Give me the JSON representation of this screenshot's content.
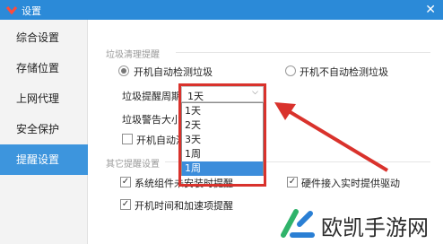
{
  "window": {
    "title": "设置"
  },
  "sidebar": {
    "items": [
      {
        "label": "综合设置"
      },
      {
        "label": "存储位置"
      },
      {
        "label": "上网代理"
      },
      {
        "label": "安全保护"
      },
      {
        "label": "提醒设置"
      }
    ],
    "active_index": 4
  },
  "cleanup_section": {
    "title": "垃圾清理提醒",
    "radio_on": "开机自动检测垃圾",
    "radio_off": "开机不自动检测垃圾",
    "interval_label": "垃圾提醒周期",
    "size_label": "垃圾警告大小",
    "startup_label": "开机自动清",
    "interval_select": {
      "value": "1天",
      "options": [
        "1天",
        "2天",
        "3天",
        "1周",
        "1周"
      ],
      "highlighted_index": 4
    }
  },
  "other_section": {
    "title": "其它提醒设置",
    "checks": [
      {
        "label": "系统组件未安装时提醒",
        "checked": true
      },
      {
        "label": "硬件接入实时提供驱动",
        "checked": true
      },
      {
        "label": "开机时间和加速项提醒",
        "checked": true
      }
    ]
  },
  "watermark": {
    "text": "欧凯手游网"
  },
  "colors": {
    "accent": "#3d95dd",
    "titlebar": "#2b8ad8",
    "annotation": "#d9322c"
  }
}
